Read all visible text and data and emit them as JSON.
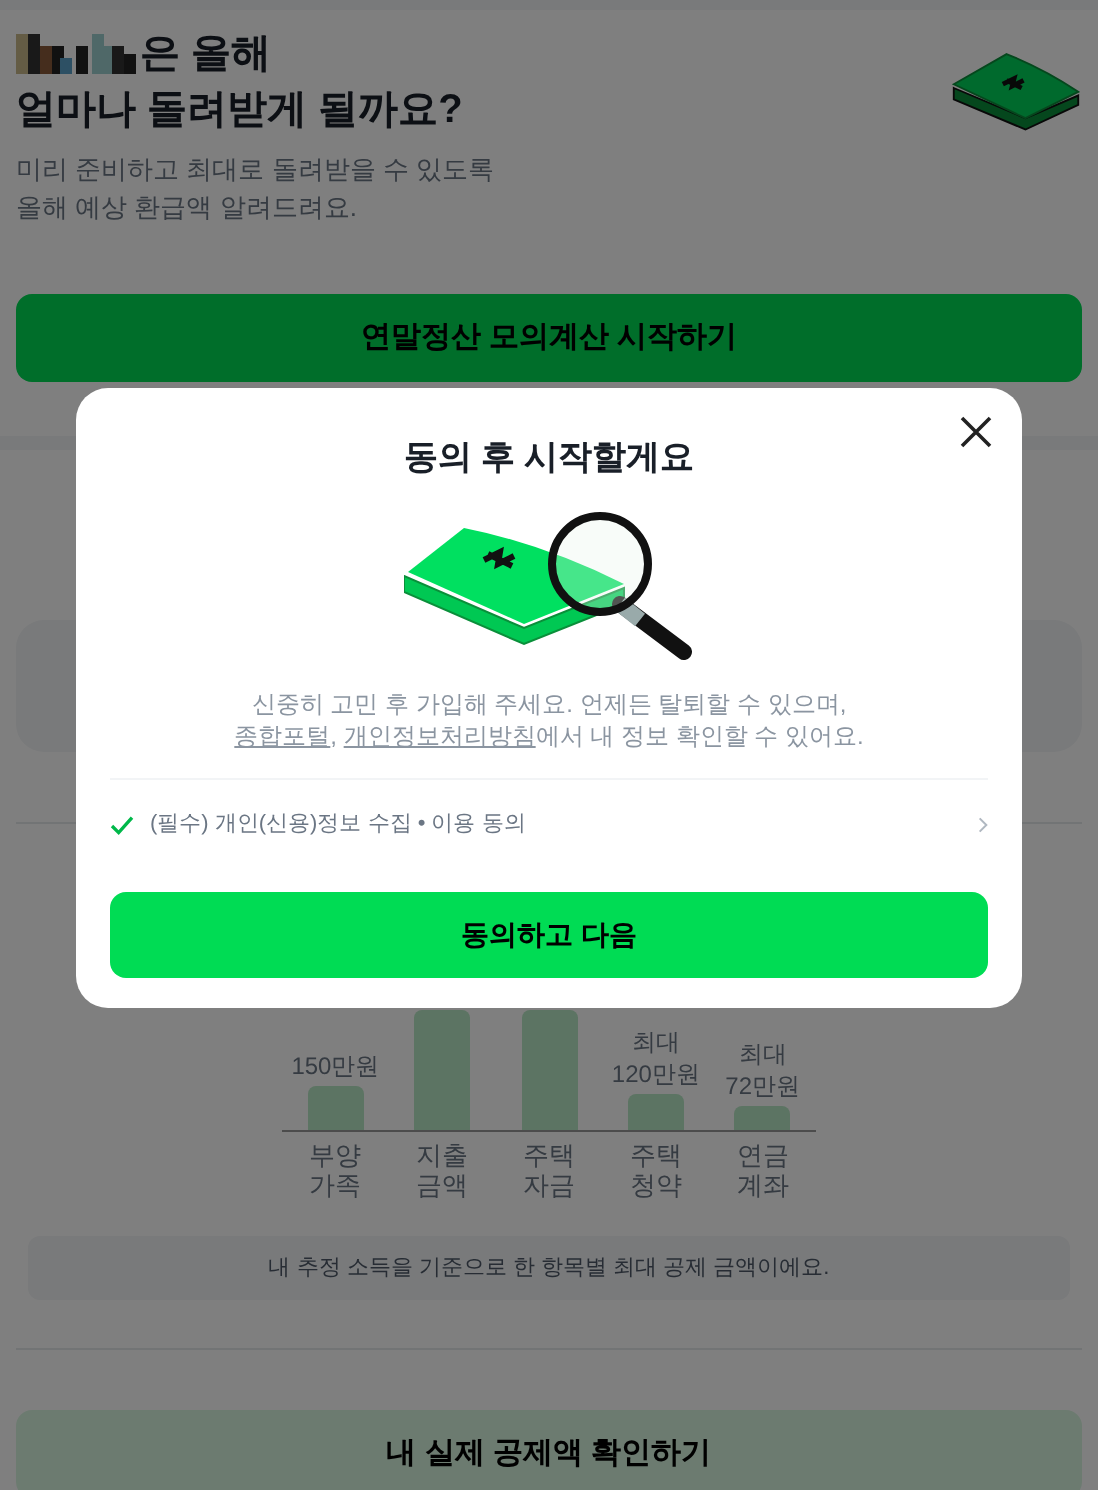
{
  "header": {
    "title_rest": "은 올해",
    "title_line2": "얼마나 돌려받게 될까요?",
    "subtitle": [
      "미리 준비하고 최대로 돌려받을 수 있도록",
      "올해 예상 환급액 알려드려요."
    ]
  },
  "start_button": "연말정산 모의계산 시작하기",
  "chart": {
    "bars": [
      {
        "value_labels": [
          "150만원"
        ],
        "category": "부양\n가족"
      },
      {
        "category": "지출\n금액"
      },
      {
        "category": "주택\n자금"
      },
      {
        "value_labels": [
          "최대",
          "120만원"
        ],
        "category": "주택\n청약"
      },
      {
        "value_labels": [
          "최대",
          "72만원"
        ],
        "category": "연금\n계좌"
      }
    ]
  },
  "notice": "내 추정 소득을 기준으로 한 항목별 최대 공제 금액이에요.",
  "confirm_button": "내 실제 공제액 확인하기",
  "modal": {
    "title": "동의 후 시작할게요",
    "description_line1": "신중히 고민 후 가입해 주세요. 언제든 탈퇴할 수 있으며,",
    "links": [
      "종합포털",
      "개인정보처리방침"
    ],
    "link_separator": ", ",
    "description_rest": "에서 내 정보 확인할 수 있어요.",
    "agreements": [
      {
        "label": "(필수) 개인(신용)정보 수집 • 이용 동의",
        "checked": true
      }
    ],
    "agree_button": "동의하고 다음"
  }
}
